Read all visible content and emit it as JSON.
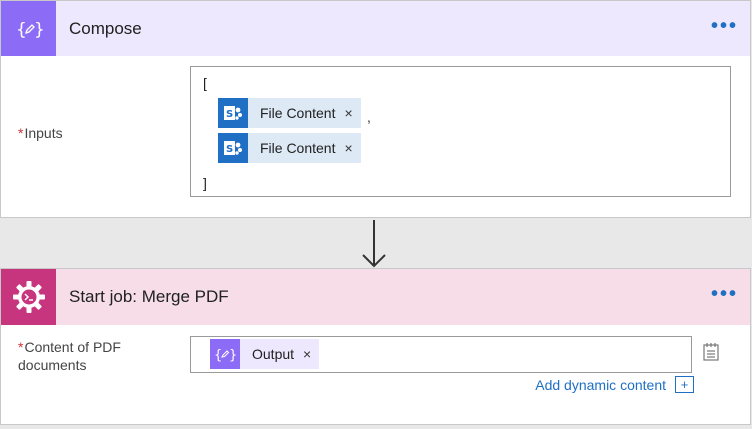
{
  "compose": {
    "title": "Compose",
    "more": "•••",
    "inputs_label": "Inputs",
    "required_mark": "*",
    "open_bracket": "[",
    "close_bracket": "]",
    "comma": ",",
    "tokens": [
      {
        "label": "File Content",
        "close": "×",
        "icon": "sharepoint-icon"
      },
      {
        "label": "File Content",
        "close": "×",
        "icon": "sharepoint-icon"
      }
    ],
    "accent": "#8c6cf7"
  },
  "merge": {
    "title": "Start job: Merge PDF",
    "more": "•••",
    "content_label_line1": "Content of PDF",
    "content_label_line2": "documents",
    "required_mark": "*",
    "token": {
      "label": "Output",
      "close": "×",
      "icon": "compose-icon"
    },
    "add_dynamic": "Add dynamic content",
    "plus": "+",
    "accent": "#c8357f",
    "header_bg": "#f6dde7"
  }
}
